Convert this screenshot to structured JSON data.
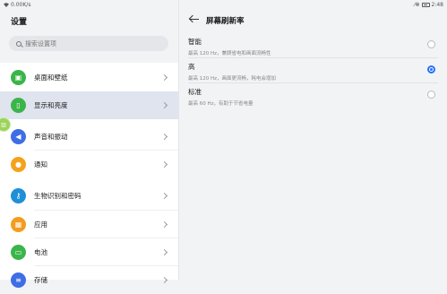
{
  "status_bar": {
    "speed": "0.00K/s",
    "time": "2:48"
  },
  "left_panel": {
    "title": "设置",
    "search_placeholder": "搜索设置项",
    "items": [
      {
        "label": "桌面和壁纸",
        "icon": "image-icon",
        "color": "#3bb54a"
      },
      {
        "label": "显示和亮度",
        "icon": "display-icon",
        "color": "#3bb54a"
      },
      {
        "label": "声音和振动",
        "icon": "volume-icon",
        "color": "#3e6de6"
      },
      {
        "label": "通知",
        "icon": "bell-icon",
        "color": "#f4a21a"
      },
      {
        "label": "生物识别和密码",
        "icon": "key-icon",
        "color": "#1f8fd8"
      },
      {
        "label": "应用",
        "icon": "apps-grid-icon",
        "color": "#f39c1f"
      },
      {
        "label": "电池",
        "icon": "battery-icon",
        "color": "#3bb54a"
      },
      {
        "label": "存储",
        "icon": "storage-icon",
        "color": "#3e6de6"
      }
    ]
  },
  "right_panel": {
    "title": "屏幕刷新率",
    "options": [
      {
        "title": "智能",
        "desc": "最高 120 Hz，兼顾省电和画面流畅性",
        "selected": false
      },
      {
        "title": "高",
        "desc": "最高 120 Hz，画面更流畅，耗电会增加",
        "selected": true
      },
      {
        "title": "标准",
        "desc": "最高 60 Hz，有助于节省电量",
        "selected": false
      }
    ]
  },
  "colors": {
    "accent": "#256fff",
    "active_row": "#dfe4ef"
  }
}
